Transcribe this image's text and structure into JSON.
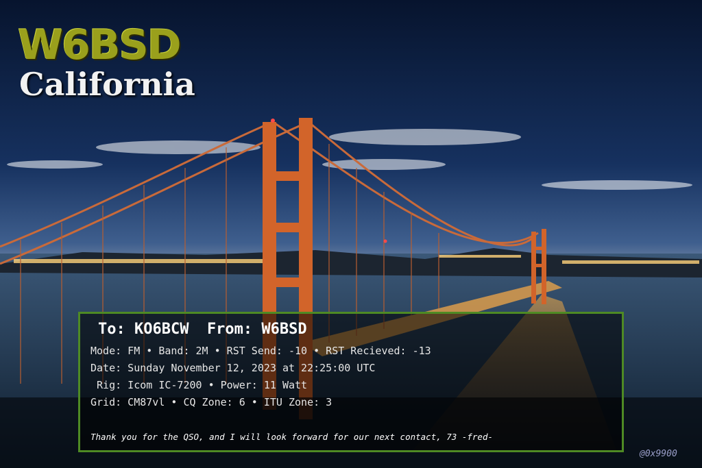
{
  "header": {
    "callsign": "W6BSD",
    "state": "California"
  },
  "card": {
    "to_from": "To: KO6BCW  From: W6BSD",
    "line1": "Mode: FM • Band: 2M • RST Send: -10 • RST Recieved: -13",
    "line2": "Date: Sunday November 12, 2023 at 22:25:00 UTC",
    "line3": " Rig: Icom IC-7200 • Power: 11 Watt",
    "line4": "Grid: CM87vl • CQ Zone: 6 • ITU Zone: 3",
    "thanks": "Thank you for the QSO, and I will look forward for our next contact, 73 -fred-"
  },
  "credit": "@0x9900",
  "colors": {
    "callsign": "#9aa01c",
    "card_border": "#4e8a24",
    "bridge": "#d2642a",
    "sky_top": "#07142e"
  }
}
